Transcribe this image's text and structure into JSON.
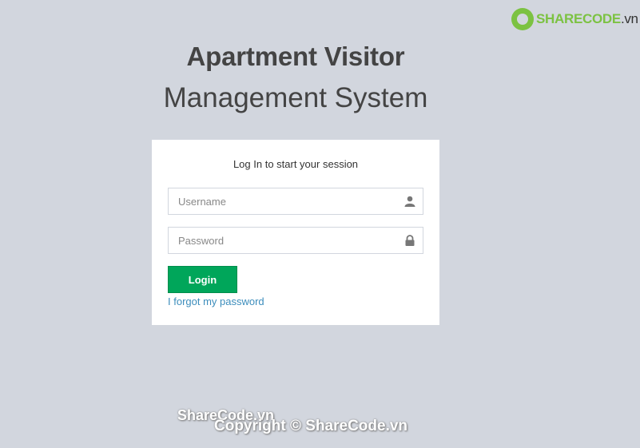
{
  "watermark": {
    "brand": "SHARECODE",
    "suffix": ".vn"
  },
  "header": {
    "title_bold": "Apartment Visitor",
    "title_light": "Management System"
  },
  "login": {
    "message": "Log In to start your session",
    "username_placeholder": "Username",
    "password_placeholder": "Password",
    "login_label": "Login",
    "forgot_label": "I forgot my password"
  },
  "footer": {
    "mark_1": "ShareCode.vn",
    "mark_2": "Copyright © ShareCode.vn"
  },
  "colors": {
    "background": "#d2d6de",
    "accent_green": "#00a65a",
    "link_blue": "#3c8dbc"
  }
}
